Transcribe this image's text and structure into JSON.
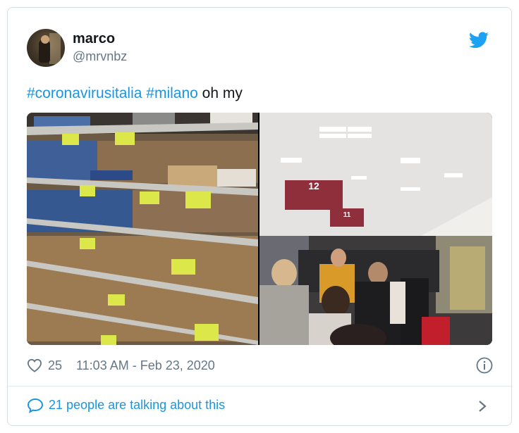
{
  "user": {
    "name": "marco",
    "handle": "@mrvnbz"
  },
  "tweet": {
    "hashtag_1": "#coronavirusitalia",
    "hashtag_2": "#milano",
    "text_tail": "oh my"
  },
  "media": {
    "aisle_sign": "12",
    "aisle_sign_2": "11"
  },
  "meta": {
    "like_count": "25",
    "timestamp": "11:03 AM - Feb 23, 2020"
  },
  "footer": {
    "talk_label": "21 people are talking about this"
  },
  "colors": {
    "link": "#1b95e0",
    "secondary": "#657786",
    "border": "#d8dfe4"
  },
  "icons": [
    "twitter-bird-icon",
    "heart-icon",
    "info-icon",
    "speech-bubble-icon",
    "chevron-right-icon"
  ]
}
